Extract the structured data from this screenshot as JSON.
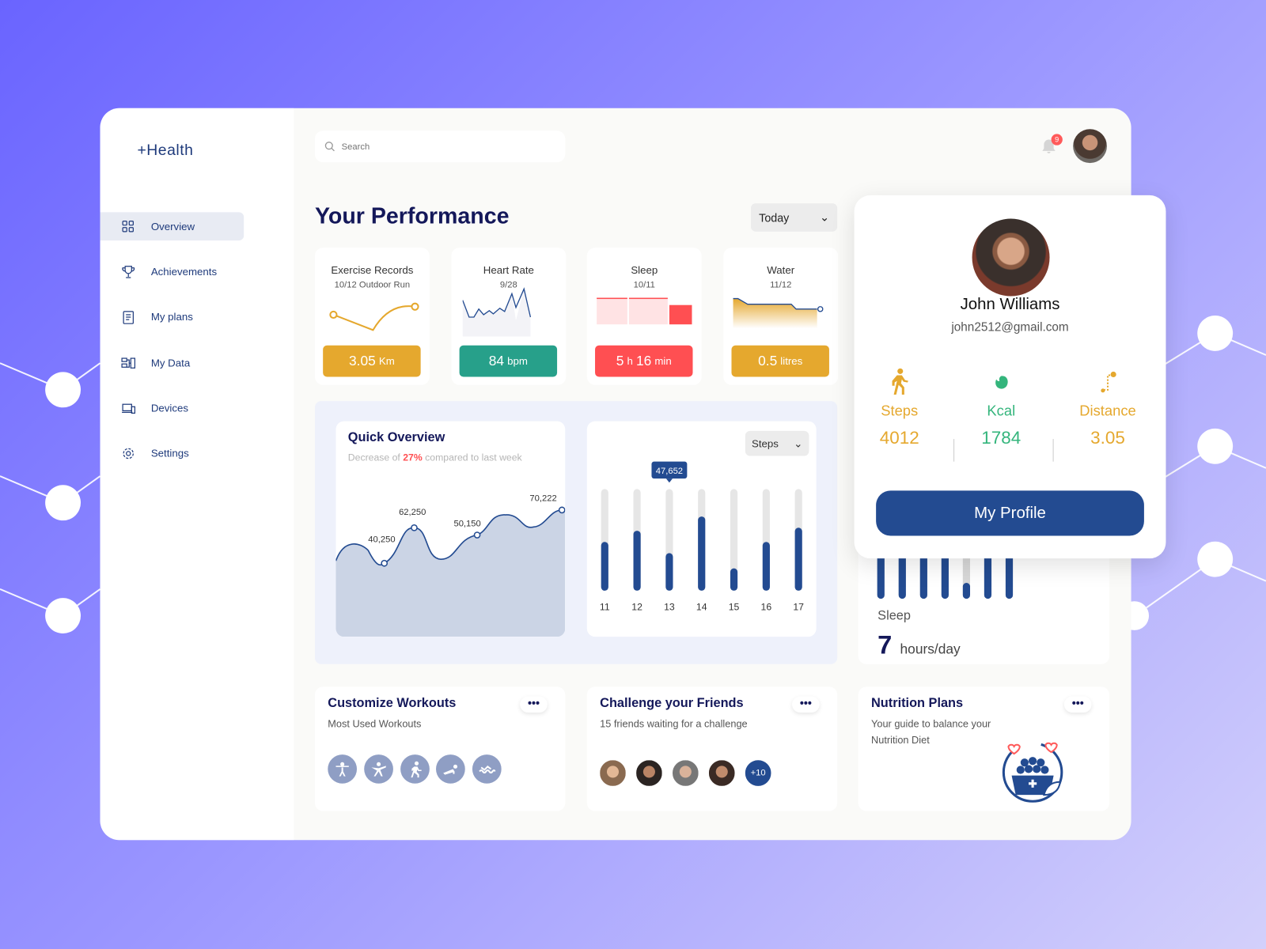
{
  "app": {
    "logo": "+Health"
  },
  "sidebar": {
    "items": [
      {
        "label": "Overview",
        "icon": "grid-icon",
        "active": true
      },
      {
        "label": "Achievements",
        "icon": "trophy-icon"
      },
      {
        "label": "My plans",
        "icon": "clipboard-icon"
      },
      {
        "label": "My Data",
        "icon": "data-icon"
      },
      {
        "label": "Devices",
        "icon": "devices-icon"
      },
      {
        "label": "Settings",
        "icon": "gear-icon"
      }
    ]
  },
  "header": {
    "search_placeholder": "Search",
    "notification_count": "9"
  },
  "main": {
    "title": "Your Performance",
    "period": "Today"
  },
  "metrics": [
    {
      "title": "Exercise Records",
      "sub": "10/12 Outdoor Run",
      "value": "3.05",
      "unit": "Km",
      "color": "#e5a82e"
    },
    {
      "title": "Heart Rate",
      "sub": "9/28",
      "value": "84",
      "unit": "bpm",
      "color": "#27a08a"
    },
    {
      "title": "Sleep",
      "sub": "10/11",
      "value": "5",
      "unit": "h",
      "value2": "16",
      "unit2": "min",
      "color": "#ff4f52"
    },
    {
      "title": "Water",
      "sub": "11/12",
      "value": "0.5",
      "unit": "litres",
      "color": "#e5a82e"
    }
  ],
  "quick_overview": {
    "title": "Quick Overview",
    "sub_pre": "Decrease of ",
    "sub_pct": "27%",
    "sub_post": " compared to last week",
    "labels": [
      "40,250",
      "62,250",
      "50,150",
      "70,222"
    ]
  },
  "steps_chart": {
    "select": "Steps",
    "tooltip": "47,652",
    "categories": [
      "11",
      "12",
      "13",
      "14",
      "15",
      "16",
      "17"
    ],
    "fill_fraction": [
      0.48,
      0.59,
      0.37,
      0.73,
      0.22,
      0.48,
      0.62
    ],
    "tooltip_index": 2
  },
  "profile": {
    "name": "John Williams",
    "email": "john2512@gmail.com",
    "stats": [
      {
        "label": "Steps",
        "value": "4012",
        "color": "#e5a82e",
        "icon": "walking-icon"
      },
      {
        "label": "Kcal",
        "value": "1784",
        "color": "#34b57c",
        "icon": "flame-icon"
      },
      {
        "label": "Distance",
        "value": "3.05",
        "color": "#e5a82e",
        "icon": "route-icon"
      }
    ],
    "button": "My Profile"
  },
  "sleep_card": {
    "label": "Sleep",
    "value": "7",
    "unit": "hours/day"
  },
  "bottom": [
    {
      "title": "Customize Workouts",
      "sub": "Most Used Workouts",
      "menu": "•••"
    },
    {
      "title": "Challenge your Friends",
      "sub": "15 friends waiting for a challenge",
      "menu": "•••",
      "more": "+10"
    },
    {
      "title": "Nutrition Plans",
      "sub": "Your guide to balance your Nutrition Diet",
      "menu": "•••"
    }
  ],
  "colors": {
    "navy": "#14185a",
    "primary": "#234b91",
    "accent_yellow": "#e5a82e",
    "accent_green": "#27a08a",
    "accent_red": "#ff4f52"
  }
}
